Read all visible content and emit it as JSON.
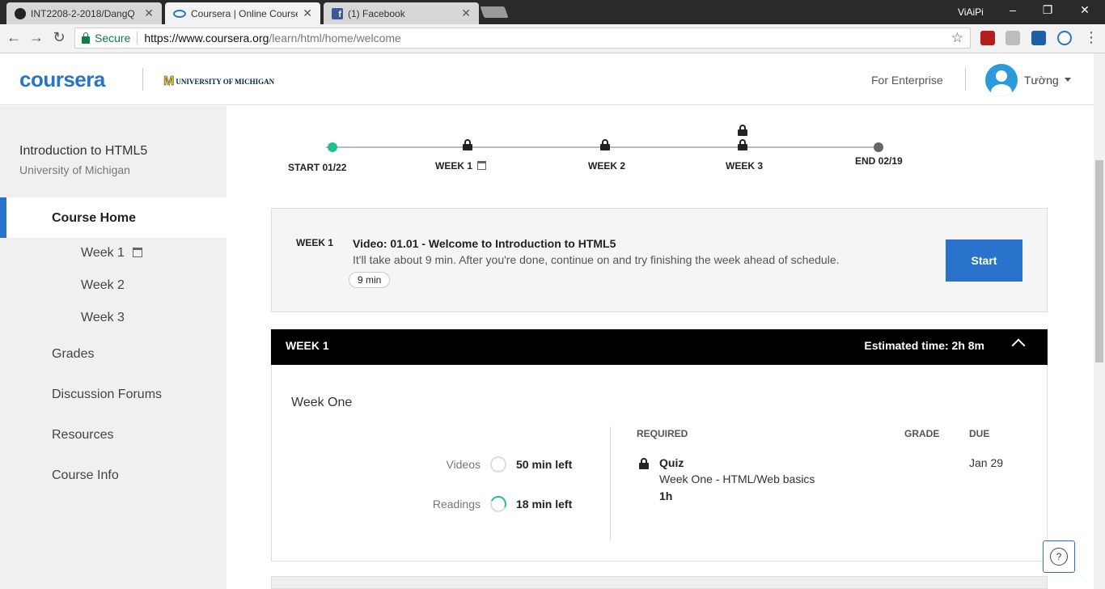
{
  "browser": {
    "tabs": [
      {
        "title": "INT2208-2-2018/DangQ",
        "icon": "github-icon"
      },
      {
        "title": "Coursera | Online Course",
        "icon": "coursera-icon"
      },
      {
        "title": "(1) Facebook",
        "icon": "facebook-icon"
      }
    ],
    "window_user": "ViAiPi",
    "secure_label": "Secure",
    "url_host": "https://www.coursera.org",
    "url_path": "/learn/html/home/welcome"
  },
  "header": {
    "logo": "coursera",
    "partner": "UNIVERSITY OF MICHIGAN",
    "partner_mark": "M",
    "enterprise": "For Enterprise",
    "username": "Tường"
  },
  "sidebar": {
    "course_title": "Introduction to HTML5",
    "course_university": "University of Michigan",
    "items": [
      {
        "label": "Course Home"
      },
      {
        "label": "Week 1"
      },
      {
        "label": "Week 2"
      },
      {
        "label": "Week 3"
      },
      {
        "label": "Grades"
      },
      {
        "label": "Discussion Forums"
      },
      {
        "label": "Resources"
      },
      {
        "label": "Course Info"
      }
    ]
  },
  "timeline": {
    "start": "START 01/22",
    "week1": "WEEK 1",
    "week2": "WEEK 2",
    "week3": "WEEK 3",
    "end": "END 02/19"
  },
  "next_item": {
    "week": "WEEK 1",
    "title": "Video: 01.01 - Welcome to Introduction to HTML5",
    "description": "It'll take about 9 min. After you're done, continue on and try finishing the week ahead of schedule.",
    "duration": "9 min",
    "start_label": "Start"
  },
  "week": {
    "header": "WEEK 1",
    "estimated": "Estimated time: 2h 8m",
    "name": "Week One",
    "stats": [
      {
        "label": "Videos",
        "value": "50 min left",
        "progress": 0
      },
      {
        "label": "Readings",
        "value": "18 min left",
        "progress": 0.3
      }
    ],
    "columns": {
      "required": "REQUIRED",
      "grade": "GRADE",
      "due": "DUE"
    },
    "quiz": {
      "title": "Quiz",
      "subtitle": "Week One - HTML/Web basics",
      "duration": "1h",
      "due": "Jan 29"
    }
  },
  "help_label": "?"
}
